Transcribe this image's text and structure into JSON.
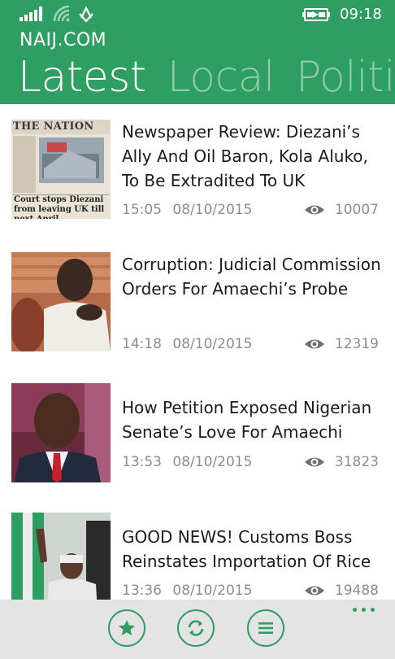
{
  "status_bar": {
    "time": "09:18",
    "icons": [
      "signal-icon",
      "wifi-icon",
      "data-icon",
      "battery-icon"
    ]
  },
  "header": {
    "app_title": "NAIJ.COM",
    "tabs": [
      {
        "label": "Latest",
        "active": true
      },
      {
        "label": "Local",
        "active": false
      },
      {
        "label": "Politics",
        "active": false
      }
    ]
  },
  "articles": [
    {
      "title": "Newspaper Review: Diezani’s Ally And Oil Baron, Kola Aluko, To Be Extradited To UK",
      "time": "15:05",
      "date": "08/10/2015",
      "views": "10007",
      "thumbnail": {
        "masthead": "THE NATION",
        "headline": "Court stops Diezani from leaving UK till next April"
      }
    },
    {
      "title": "Corruption: Judicial Commission Orders For Amaechi’s Probe",
      "time": "14:18",
      "date": "08/10/2015",
      "views": "12319"
    },
    {
      "title": "How Petition Exposed Nigerian Senate’s Love For Amaechi",
      "time": "13:53",
      "date": "08/10/2015",
      "views": "31823"
    },
    {
      "title": "GOOD NEWS! Customs Boss Reinstates Importation Of Rice",
      "time": "13:36",
      "date": "08/10/2015",
      "views": "19488"
    }
  ],
  "app_bar": {
    "buttons": [
      "favorites-icon",
      "refresh-icon",
      "menu-icon"
    ],
    "more": "more-icon"
  },
  "colors": {
    "accent": "#2e9e62",
    "meta_text": "#8c8c8c",
    "app_bar_bg": "#e4e4e4"
  }
}
